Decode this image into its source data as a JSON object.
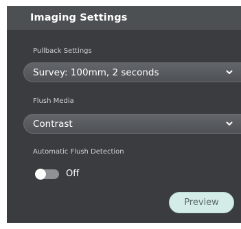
{
  "panel": {
    "title": "Imaging Settings"
  },
  "pullback": {
    "label": "Pullback Settings",
    "selected": "Survey: 100mm, 2 seconds",
    "icon": "chevron-down-icon"
  },
  "flush_media": {
    "label": "Flush Media",
    "selected": "Contrast",
    "icon": "chevron-down-icon"
  },
  "auto_flush": {
    "label": "Automatic Flush Detection",
    "state_label": "Off",
    "enabled": false
  },
  "actions": {
    "preview_label": "Preview"
  },
  "colors": {
    "panel_bg": "#3a3c3f",
    "header_bg": "#4d5053",
    "select_bg": "#585b5f",
    "accent_button": "#d3ece7",
    "toggle_off": "#8e9296"
  }
}
